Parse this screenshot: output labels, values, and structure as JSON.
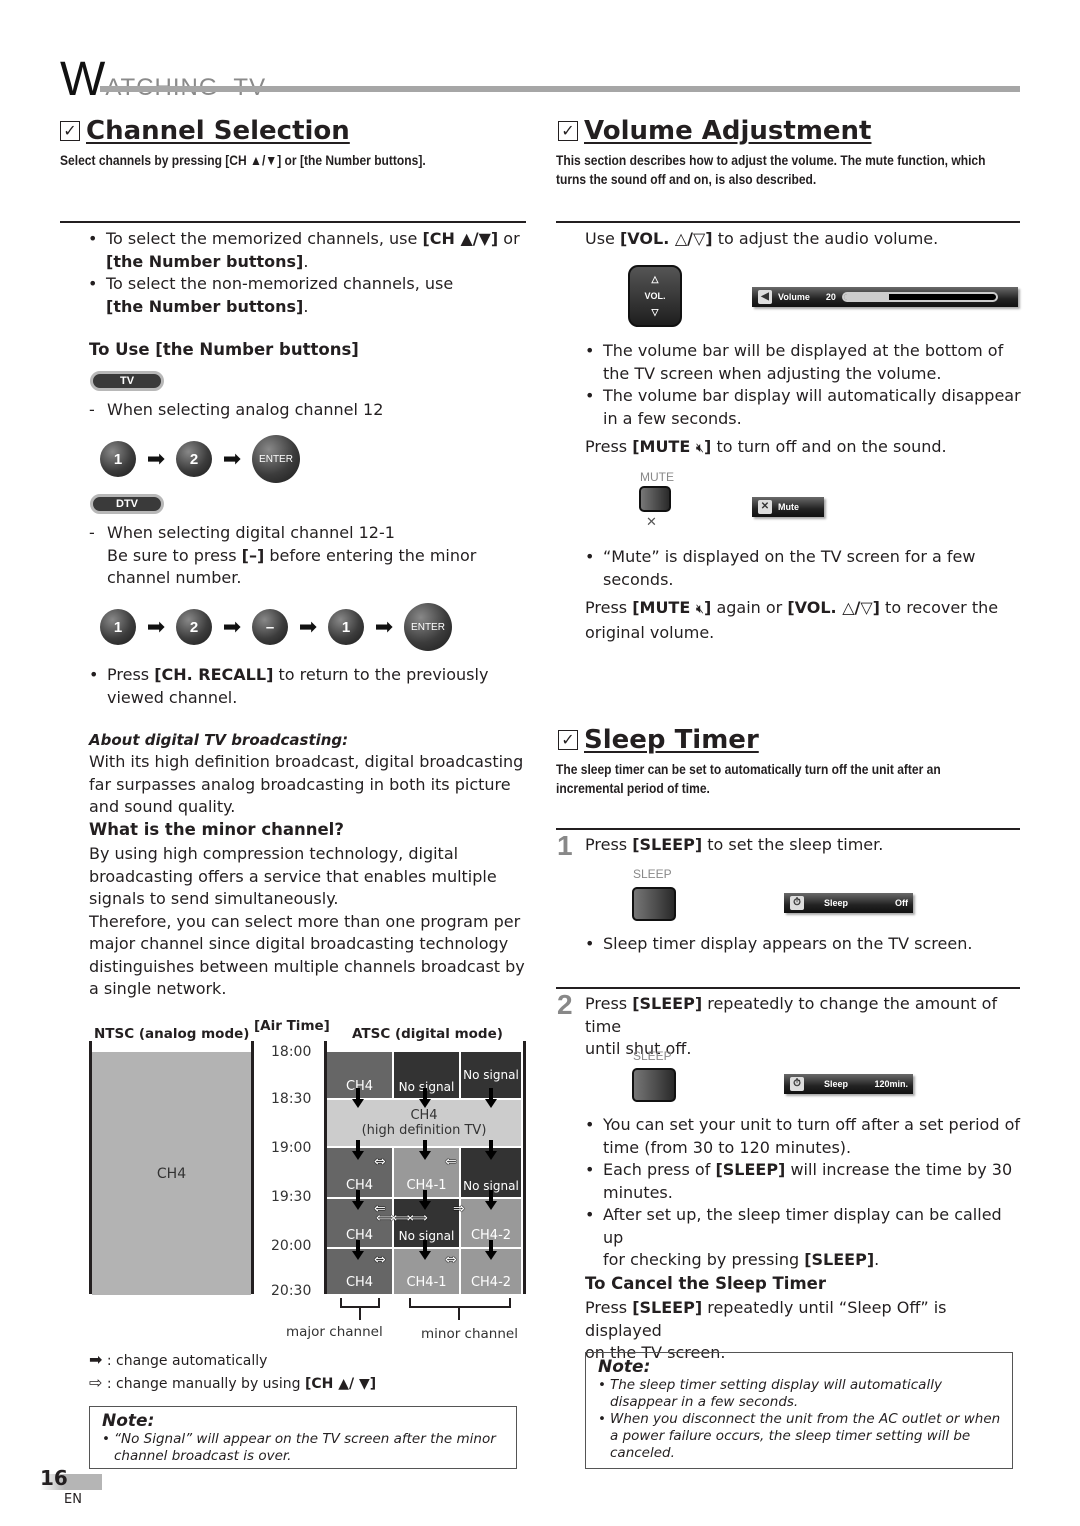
{
  "header": {
    "title_initial": "W",
    "title_rest": "ATCHING  TV"
  },
  "channel_selection": {
    "title": "Channel Selection",
    "lead": "Select channels by pressing [CH ▲/▼] or [the Number buttons].",
    "bullets": [
      {
        "pre": "To select the memorized channels, use ",
        "bold": "[CH ▲/▼]",
        "post": " or",
        "line2_bold": "[the Number buttons]",
        "line2_post": "."
      },
      {
        "pre": "To select the non-memorized channels, use",
        "bold": "",
        "post": "",
        "line2_bold": "[the Number buttons]",
        "line2_post": "."
      }
    ],
    "number_buttons_heading": "To Use [the Number buttons]",
    "tv_pill": "TV",
    "analog_text": "When selecting analog channel 12",
    "analog_sequence": [
      "1",
      "2",
      "ENTER"
    ],
    "dtv_pill": "DTV",
    "digital_text_1": "When selecting digital channel 12-1",
    "digital_text_2_pre": "Be sure to press ",
    "digital_text_2_bold": "[–]",
    "digital_text_2_post": " before entering the minor",
    "digital_text_3": "channel number.",
    "digital_sequence": [
      "1",
      "2",
      "–",
      "1",
      "ENTER"
    ],
    "recall_pre": "Press ",
    "recall_bold": "[CH. RECALL]",
    "recall_post": " to return to the previously",
    "recall_line2": "viewed channel.",
    "about_heading": "About digital TV broadcasting:",
    "about_lines": [
      "With its high definition broadcast, digital broadcasting",
      "far surpasses analog broadcasting in both its picture",
      "and sound quality."
    ],
    "minor_heading": "What is the minor channel?",
    "minor_lines": [
      "By using high compression technology, digital",
      "broadcasting offers a service that enables multiple",
      "signals to send simultaneously.",
      "Therefore, you can select more than one program per",
      "major channel since digital broadcasting technology",
      "distinguishes between multiple channels broadcast by",
      "a single network."
    ],
    "diagram": {
      "ntsc_header": "NTSC (analog mode)",
      "airtime_header": "[Air Time]",
      "atsc_header": "ATSC (digital mode)",
      "ntsc_channel": "CH4",
      "times": [
        "18:00",
        "18:30",
        "19:00",
        "19:30",
        "20:00",
        "20:30"
      ],
      "rows": [
        [
          "CH4",
          "No signal",
          "No signal"
        ],
        [
          "CH4\n(high definition TV)"
        ],
        [
          "CH4",
          "CH4-1",
          "No signal"
        ],
        [
          "CH4",
          "No signal",
          "CH4-2"
        ],
        [
          "CH4",
          "CH4-1",
          "CH4-2"
        ]
      ],
      "hd_line1": "CH4",
      "hd_line2": "(high definition TV)",
      "major_label": "major channel",
      "minor_label": "minor channel"
    },
    "legend_auto": ": change automatically",
    "legend_manual_pre": ": change manually by using ",
    "legend_manual_bold": "[CH ▲/ ▼]",
    "note_title": "Note:",
    "note_items": [
      "“No Signal” will appear on the TV screen after the minor channel broadcast is over."
    ]
  },
  "volume_adjustment": {
    "title": "Volume Adjustment",
    "lead_1": "This section describes how to adjust the volume. The mute function, which",
    "lead_2": "turns the sound off and on, is also described.",
    "use_pre": "Use ",
    "use_bold": "[VOL. △/▽]",
    "use_post": " to adjust the audio volume.",
    "vol_button_label": "VOL.",
    "osd_label": "Volume",
    "osd_value": "20",
    "osd_level_fraction": 0.3,
    "bullets": [
      "The volume bar will be displayed at the bottom of the TV screen when adjusting the volume.",
      "The volume bar display will automatically disappear in a few seconds."
    ],
    "mute_pre": "Press ",
    "mute_bold": "[MUTE ",
    "mute_post": " to turn off and on the sound.",
    "mute_btn_caption": "MUTE",
    "mute_osd_label": "Mute",
    "mute_bullet": "“Mute” is displayed on the TV screen for a few seconds.",
    "recover_line1_pre": "Press ",
    "recover_line1_bold1": "[MUTE ",
    "recover_line1_mid": " again or ",
    "recover_line1_bold2": "[VOL. △/▽]",
    "recover_line1_post": " to recover the",
    "recover_line2": "original volume."
  },
  "sleep_timer": {
    "title": "Sleep Timer",
    "lead_1": "The sleep timer can be set to automatically turn off the unit after an",
    "lead_2": "incremental period of time.",
    "step1_num": "1",
    "step1_pre": "Press ",
    "step1_bold": "[SLEEP]",
    "step1_post": " to set the sleep timer.",
    "sleep_caption": "SLEEP",
    "osd1_label": "Sleep",
    "osd1_value": "Off",
    "step1_bullet": "Sleep timer display appears on the TV screen.",
    "step2_num": "2",
    "step2_pre": "Press ",
    "step2_bold": "[SLEEP]",
    "step2_post": " repeatedly to change the amount of time",
    "step2_line2": "until shut off.",
    "osd2_label": "Sleep",
    "osd2_value": "120min.",
    "step2_bullets": [
      {
        "pre": "You can set your unit to turn off after a set period of",
        "line2": "time (from 30 to 120 minutes)."
      },
      {
        "pre": "Each press of ",
        "bold": "[SLEEP]",
        "post": " will increase the time by 30",
        "line2": "minutes."
      },
      {
        "pre": "After set up, the sleep timer display can be called up",
        "line2_pre": "for checking by pressing ",
        "line2_bold": "[SLEEP]",
        "line2_post": "."
      }
    ],
    "cancel_heading": "To Cancel the Sleep Timer",
    "cancel_pre": "Press ",
    "cancel_bold": "[SLEEP]",
    "cancel_post": " repeatedly until “Sleep Off” is displayed",
    "cancel_line2": "on the TV screen.",
    "note_title": "Note:",
    "note_items": [
      [
        "The sleep timer setting display will automatically",
        "disappear in a few seconds."
      ],
      [
        "When you disconnect the unit from the AC outlet or when",
        "a power failure occurs, the sleep timer setting will be",
        "canceled."
      ]
    ]
  },
  "footer": {
    "page_number": "16",
    "language": "EN"
  }
}
